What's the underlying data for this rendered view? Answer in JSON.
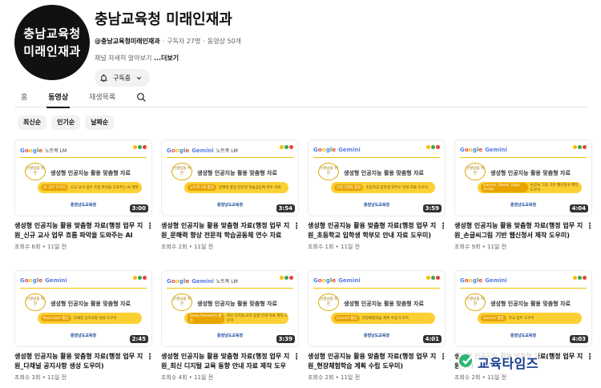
{
  "channel": {
    "avatar_line1": "충남교육청",
    "avatar_line2": "미래인재과",
    "name": "충남교육청 미래인재과",
    "handle": "@충남교육청미래인재과",
    "subscribers": "구독자 27명",
    "videos": "동영상 50개",
    "desc": "채널 자세히 알아보기",
    "more": "...더보기",
    "subscribe_label": "구독중"
  },
  "tabs": {
    "home": "홈",
    "videos": "동영상",
    "playlists": "재생목록"
  },
  "chips": [
    "최신순",
    "인기순",
    "날짜순"
  ],
  "thumb_common": {
    "main_title": "생성형 인공지능 활용 맞춤형 자료",
    "org": "충청남도교육청",
    "bubble": "선생님을 위한",
    "gemini": "Gemini",
    "notebook": "노트북 LM",
    "google": [
      "G",
      "o",
      "o",
      "g",
      "l",
      "e"
    ]
  },
  "colors": {
    "logo_blue": "#4285f4",
    "logo_red": "#ea4335",
    "logo_yellow": "#fbbc05",
    "logo_green": "#34a853",
    "band": "#fbd033",
    "watermark": "#123a8a"
  },
  "videos": [
    {
      "title": "생성형 인공지능 활용 맞춤형 자료(행정 업무 지원_신규 교사 업무 흐름 파악을 도와주는 AI 챗...",
      "meta": "조회수 6회 • 11일 전",
      "duration": "3:00",
      "brand": "notebook",
      "band_pill": "AI 교무 도우미",
      "band_text": "신규 교사 업무 흐름 파악을 도와주는 AI 챗봇"
    },
    {
      "title": "생성형 인공지능 활용 맞춤형 자료(행정 업무 지원_문해력 향상 전문적 학습공동체 연수 자료 ...",
      "meta": "조회수 2회 • 11일 전",
      "duration": "3:54",
      "brand": "gemini-notebook",
      "band_pill": "노트북 LM 활용",
      "band_text": "문해력 향상 전문적 학습공동체 연수 자료"
    },
    {
      "title": "생성형 인공지능 활용 맞춤형 자료(행정 업무 지원_초등학교 입학생 학부모 안내 자료 도우미)",
      "meta": "조회수 1회 • 11일 전",
      "duration": "3:59",
      "brand": "google",
      "band_pill": "인포그래픽 활용",
      "band_text": "초등학교 입학생 학부모 안내 자료 도우미"
    },
    {
      "title": "생성형 인공지능 활용 맞춤형 자료(행정 업무 지원_손글씨그림 기반 웹신청서 제작 도우미)",
      "meta": "조회수 9회 • 11일 전",
      "duration": "4:04",
      "brand": "gemini",
      "band_pill": "Gemini, Sheet, Apps Script",
      "band_text": "손글씨 그림 기반 웹신청서 제작 도우미"
    },
    {
      "title": "생성형 인공지능 활용 맞춤형 자료(행정 업무 지원_다채널 공지사항 생성 도우미)",
      "meta": "조회수 3회 • 11일 전",
      "duration": "2:45",
      "brand": "gemini",
      "band_pill": "New Gem 활용",
      "band_text": "다채널 공지사항 생성 도우미"
    },
    {
      "title": "생성형 인공지능 활용 맞춤형 자료(행정 업무 지원_최신 디지털 교육 동향 안내 자료 제작 도우미)",
      "meta": "조회수 4회 • 11일 전",
      "duration": "3:39",
      "brand": "gemini-notebook",
      "band_pill": "Deep Research 활용",
      "band_text": "최신 디지털 교육 동향 안내 자료 제작 도우미"
    },
    {
      "title": "생성형 인공지능 활용 맞춤형 자료(행정 업무 지원_현장체험학습 계획 수립 도우미)",
      "meta": "조회수 2회 • 11일 전",
      "duration": "4:01",
      "brand": "google",
      "band_pill": "Gemini 활용",
      "band_text": "현장체험학습 계획 수립 도우미"
    },
    {
      "title": "생성형 인공지능 활용 맞춤형 자료(행정 업무 지원_...)",
      "meta": "조회수 2회 • 11일 전",
      "duration": "4:03",
      "brand": "google",
      "band_pill": "Gemini 활용",
      "band_text": "학교 업무 도우미"
    }
  ],
  "watermark": {
    "text": "교육타임즈"
  }
}
